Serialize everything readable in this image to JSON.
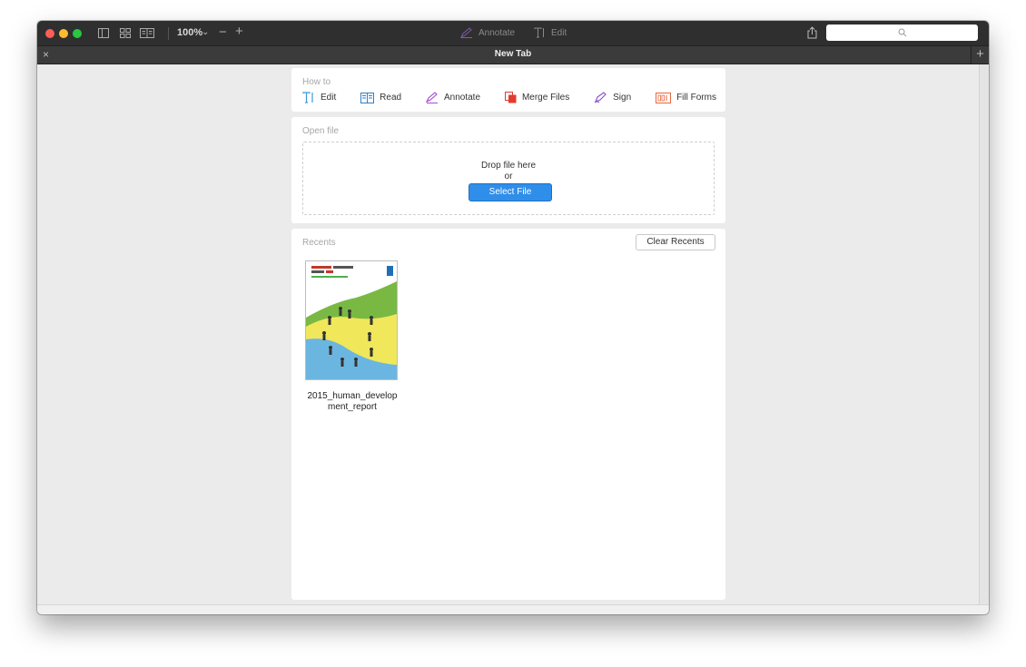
{
  "toolbar": {
    "zoom": "100%",
    "zoom_caret": "⌄",
    "zoom_out": "−",
    "zoom_in": "+",
    "annotate_label": "Annotate",
    "edit_label": "Edit"
  },
  "tab": {
    "close": "×",
    "title": "New Tab",
    "new": "+"
  },
  "howto": {
    "title": "How to",
    "items": [
      {
        "label": "Edit",
        "icon": "text-cursor-icon"
      },
      {
        "label": "Read",
        "icon": "read-icon"
      },
      {
        "label": "Annotate",
        "icon": "pen-icon"
      },
      {
        "label": "Merge Files",
        "icon": "merge-icon"
      },
      {
        "label": "Sign",
        "icon": "signature-icon"
      },
      {
        "label": "Fill Forms",
        "icon": "form-field-icon"
      }
    ]
  },
  "openfile": {
    "title": "Open file",
    "drop_text": "Drop file here",
    "or_text": "or",
    "select_label": "Select File"
  },
  "recents": {
    "title": "Recents",
    "clear_label": "Clear Recents",
    "files": [
      {
        "name": "2015_human_development_report"
      }
    ]
  },
  "colors": {
    "accent": "#2f8ee9",
    "toolbar_bg": "#2f2f2f",
    "edit_icon": "#3a9bd9",
    "annotate_icon": "#a24ad6",
    "merge_icon": "#e23b2f",
    "fill_forms_icon": "#e8663c"
  }
}
